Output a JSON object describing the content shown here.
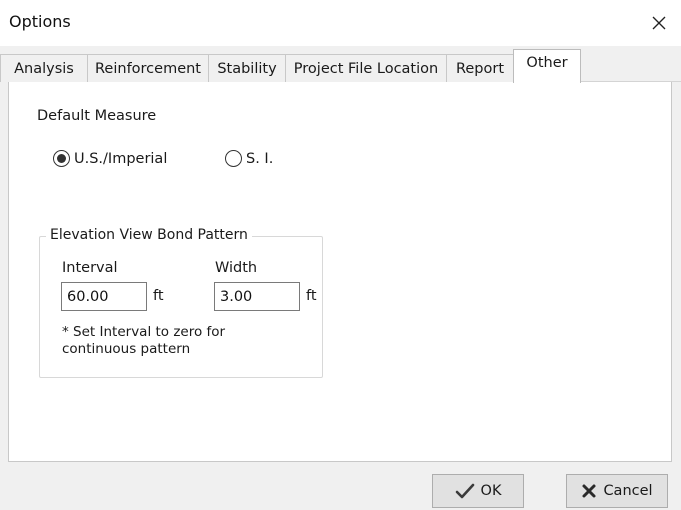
{
  "window": {
    "title": "Options"
  },
  "tabs": [
    {
      "label": "Analysis"
    },
    {
      "label": "Reinforcement"
    },
    {
      "label": "Stability"
    },
    {
      "label": "Project File Location"
    },
    {
      "label": "Report"
    },
    {
      "label": "Other"
    }
  ],
  "active_tab": "Other",
  "default_measure": {
    "heading": "Default Measure",
    "options": [
      {
        "label": "U.S./Imperial",
        "selected": true
      },
      {
        "label": "S. I.",
        "selected": false
      }
    ]
  },
  "bond_pattern": {
    "title": "Elevation View Bond Pattern",
    "interval_label": "Interval",
    "interval_value": "60.00",
    "interval_unit": "ft",
    "width_label": "Width",
    "width_value": "3.00",
    "width_unit": "ft",
    "note": "* Set Interval to zero for continuous pattern"
  },
  "buttons": {
    "ok_label": "OK",
    "cancel_label": "Cancel"
  },
  "icons": {
    "close": "close-icon",
    "ok": "checkmark-icon",
    "cancel": "x-mark-icon"
  },
  "colors": {
    "window_bg": "#f0f0f0",
    "panel_bg": "#ffffff",
    "button_bg": "#e1e1e1"
  }
}
